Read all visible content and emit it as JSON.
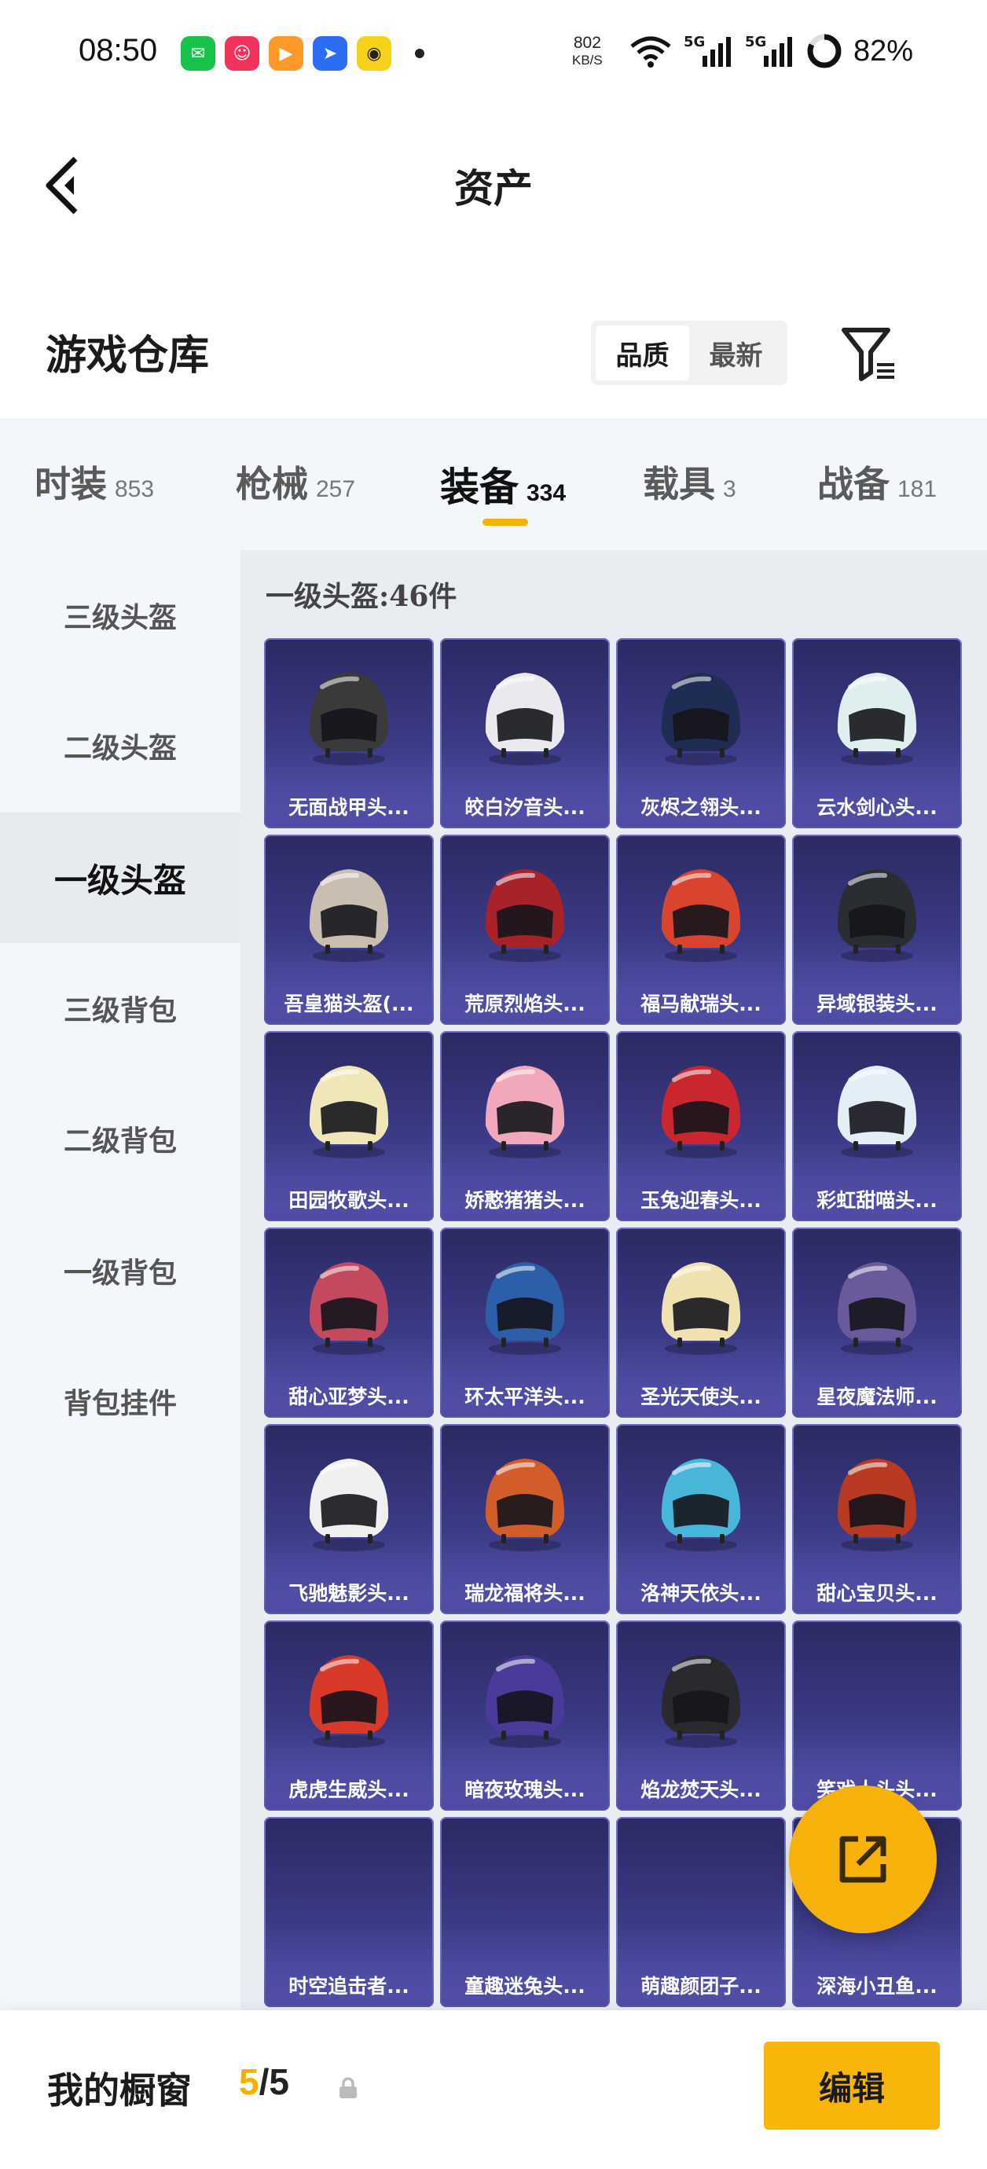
{
  "status_bar": {
    "time": "08:50",
    "net_speed_value": "802",
    "net_speed_unit": "KB/S",
    "signal_1": "5G",
    "signal_2": "5G",
    "battery": "82%",
    "app_icons": [
      "wechat-icon",
      "app-red-icon",
      "app-orange-icon",
      "app-blue-icon",
      "app-yellow-icon"
    ]
  },
  "header": {
    "title": "资产"
  },
  "section": {
    "title": "游戏仓库",
    "sort_options": [
      "品质",
      "最新"
    ],
    "sort_active": "品质"
  },
  "tabs": [
    {
      "label": "时装",
      "count": "853"
    },
    {
      "label": "枪械",
      "count": "257"
    },
    {
      "label": "装备",
      "count": "334"
    },
    {
      "label": "载具",
      "count": "3"
    },
    {
      "label": "战备",
      "count": "181"
    }
  ],
  "tab_active": "装备",
  "sidebar": {
    "items": [
      "三级头盔",
      "二级头盔",
      "一级头盔",
      "三级背包",
      "二级背包",
      "一级背包",
      "背包挂件"
    ],
    "active": "一级头盔"
  },
  "content": {
    "heading": "一级头盔:46件",
    "items": [
      {
        "name": "无面战甲头...",
        "icon": "helmet-black-icon",
        "color": "#3a3a3a"
      },
      {
        "name": "皎白汐音头...",
        "icon": "helmet-white-icon",
        "color": "#e9e9ee"
      },
      {
        "name": "灰烬之翎头...",
        "icon": "helmet-navy-icon",
        "color": "#1f2d55"
      },
      {
        "name": "云水剑心头...",
        "icon": "helmet-pale-icon",
        "color": "#dfeeee"
      },
      {
        "name": "吾皇猫头盔(...",
        "icon": "helmet-cat-icon",
        "color": "#c9beb0"
      },
      {
        "name": "荒原烈焰头...",
        "icon": "helmet-red-icon",
        "color": "#a8222a"
      },
      {
        "name": "福马献瑞头...",
        "icon": "helmet-orange-red-icon",
        "color": "#d8442e"
      },
      {
        "name": "异域银装头...",
        "icon": "helmet-dark-teal-icon",
        "color": "#2a2e33"
      },
      {
        "name": "田园牧歌头...",
        "icon": "helmet-cream-icon",
        "color": "#efe7b8"
      },
      {
        "name": "娇憨猪猪头...",
        "icon": "helmet-pink-icon",
        "color": "#f2a8bb"
      },
      {
        "name": "玉兔迎春头...",
        "icon": "helmet-rabbit-icon",
        "color": "#c92630"
      },
      {
        "name": "彩虹甜喵头...",
        "icon": "helmet-lightblue-icon",
        "color": "#e3eef7"
      },
      {
        "name": "甜心亚梦头...",
        "icon": "helmet-rose-icon",
        "color": "#c34a5e"
      },
      {
        "name": "环太平洋头...",
        "icon": "helmet-blue-icon",
        "color": "#2d5fa8"
      },
      {
        "name": "圣光天使头...",
        "icon": "helmet-gold-icon",
        "color": "#efe2b0"
      },
      {
        "name": "星夜魔法师...",
        "icon": "helmet-purple-icon",
        "color": "#6a5a9c"
      },
      {
        "name": "飞驰魅影头...",
        "icon": "helmet-racer-icon",
        "color": "#f0f0f0"
      },
      {
        "name": "瑞龙福将头...",
        "icon": "helmet-dragon-icon",
        "color": "#d25c2a"
      },
      {
        "name": "洛神天依头...",
        "icon": "helmet-cyan-icon",
        "color": "#48b6d8"
      },
      {
        "name": "甜心宝贝头...",
        "icon": "helmet-visor-icon",
        "color": "#b83a22"
      },
      {
        "name": "虎虎生威头...",
        "icon": "helmet-tiger-icon",
        "color": "#d83a2a"
      },
      {
        "name": "暗夜玫瑰头...",
        "icon": "helmet-violet-icon",
        "color": "#4a3a9a"
      },
      {
        "name": "焰龙焚天头...",
        "icon": "helmet-dark-icon",
        "color": "#2a2a2e"
      },
      {
        "name": "笑戏人头头...",
        "icon": "empty-icon",
        "color": ""
      },
      {
        "name": "时空追击者...",
        "icon": "empty-icon",
        "color": ""
      },
      {
        "name": "童趣迷兔头...",
        "icon": "empty-icon",
        "color": ""
      },
      {
        "name": "萌趣颜团子...",
        "icon": "empty-icon",
        "color": ""
      },
      {
        "name": "深海小丑鱼...",
        "icon": "empty-icon",
        "color": ""
      }
    ]
  },
  "bottom_bar": {
    "label": "我的橱窗",
    "current": "5",
    "separator": "/",
    "total": "5",
    "edit_label": "编辑"
  },
  "colors": {
    "accent": "#f7b100",
    "card_top": "#2b2a62",
    "card_bottom": "#5b58b6"
  }
}
